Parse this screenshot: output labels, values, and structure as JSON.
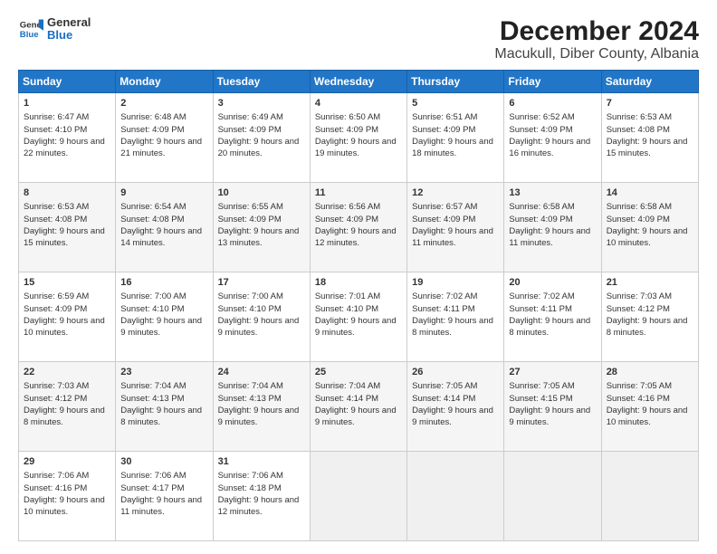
{
  "header": {
    "logo_general": "General",
    "logo_blue": "Blue",
    "title": "December 2024",
    "subtitle": "Macukull, Diber County, Albania"
  },
  "days_of_week": [
    "Sunday",
    "Monday",
    "Tuesday",
    "Wednesday",
    "Thursday",
    "Friday",
    "Saturday"
  ],
  "weeks": [
    [
      {
        "day": "1",
        "sunrise": "6:47 AM",
        "sunset": "4:10 PM",
        "daylight": "9 hours and 22 minutes."
      },
      {
        "day": "2",
        "sunrise": "6:48 AM",
        "sunset": "4:09 PM",
        "daylight": "9 hours and 21 minutes."
      },
      {
        "day": "3",
        "sunrise": "6:49 AM",
        "sunset": "4:09 PM",
        "daylight": "9 hours and 20 minutes."
      },
      {
        "day": "4",
        "sunrise": "6:50 AM",
        "sunset": "4:09 PM",
        "daylight": "9 hours and 19 minutes."
      },
      {
        "day": "5",
        "sunrise": "6:51 AM",
        "sunset": "4:09 PM",
        "daylight": "9 hours and 18 minutes."
      },
      {
        "day": "6",
        "sunrise": "6:52 AM",
        "sunset": "4:09 PM",
        "daylight": "9 hours and 16 minutes."
      },
      {
        "day": "7",
        "sunrise": "6:53 AM",
        "sunset": "4:08 PM",
        "daylight": "9 hours and 15 minutes."
      }
    ],
    [
      {
        "day": "8",
        "sunrise": "6:53 AM",
        "sunset": "4:08 PM",
        "daylight": "9 hours and 15 minutes."
      },
      {
        "day": "9",
        "sunrise": "6:54 AM",
        "sunset": "4:08 PM",
        "daylight": "9 hours and 14 minutes."
      },
      {
        "day": "10",
        "sunrise": "6:55 AM",
        "sunset": "4:09 PM",
        "daylight": "9 hours and 13 minutes."
      },
      {
        "day": "11",
        "sunrise": "6:56 AM",
        "sunset": "4:09 PM",
        "daylight": "9 hours and 12 minutes."
      },
      {
        "day": "12",
        "sunrise": "6:57 AM",
        "sunset": "4:09 PM",
        "daylight": "9 hours and 11 minutes."
      },
      {
        "day": "13",
        "sunrise": "6:58 AM",
        "sunset": "4:09 PM",
        "daylight": "9 hours and 11 minutes."
      },
      {
        "day": "14",
        "sunrise": "6:58 AM",
        "sunset": "4:09 PM",
        "daylight": "9 hours and 10 minutes."
      }
    ],
    [
      {
        "day": "15",
        "sunrise": "6:59 AM",
        "sunset": "4:09 PM",
        "daylight": "9 hours and 10 minutes."
      },
      {
        "day": "16",
        "sunrise": "7:00 AM",
        "sunset": "4:10 PM",
        "daylight": "9 hours and 9 minutes."
      },
      {
        "day": "17",
        "sunrise": "7:00 AM",
        "sunset": "4:10 PM",
        "daylight": "9 hours and 9 minutes."
      },
      {
        "day": "18",
        "sunrise": "7:01 AM",
        "sunset": "4:10 PM",
        "daylight": "9 hours and 9 minutes."
      },
      {
        "day": "19",
        "sunrise": "7:02 AM",
        "sunset": "4:11 PM",
        "daylight": "9 hours and 8 minutes."
      },
      {
        "day": "20",
        "sunrise": "7:02 AM",
        "sunset": "4:11 PM",
        "daylight": "9 hours and 8 minutes."
      },
      {
        "day": "21",
        "sunrise": "7:03 AM",
        "sunset": "4:12 PM",
        "daylight": "9 hours and 8 minutes."
      }
    ],
    [
      {
        "day": "22",
        "sunrise": "7:03 AM",
        "sunset": "4:12 PM",
        "daylight": "9 hours and 8 minutes."
      },
      {
        "day": "23",
        "sunrise": "7:04 AM",
        "sunset": "4:13 PM",
        "daylight": "9 hours and 8 minutes."
      },
      {
        "day": "24",
        "sunrise": "7:04 AM",
        "sunset": "4:13 PM",
        "daylight": "9 hours and 9 minutes."
      },
      {
        "day": "25",
        "sunrise": "7:04 AM",
        "sunset": "4:14 PM",
        "daylight": "9 hours and 9 minutes."
      },
      {
        "day": "26",
        "sunrise": "7:05 AM",
        "sunset": "4:14 PM",
        "daylight": "9 hours and 9 minutes."
      },
      {
        "day": "27",
        "sunrise": "7:05 AM",
        "sunset": "4:15 PM",
        "daylight": "9 hours and 9 minutes."
      },
      {
        "day": "28",
        "sunrise": "7:05 AM",
        "sunset": "4:16 PM",
        "daylight": "9 hours and 10 minutes."
      }
    ],
    [
      {
        "day": "29",
        "sunrise": "7:06 AM",
        "sunset": "4:16 PM",
        "daylight": "9 hours and 10 minutes."
      },
      {
        "day": "30",
        "sunrise": "7:06 AM",
        "sunset": "4:17 PM",
        "daylight": "9 hours and 11 minutes."
      },
      {
        "day": "31",
        "sunrise": "7:06 AM",
        "sunset": "4:18 PM",
        "daylight": "9 hours and 12 minutes."
      },
      null,
      null,
      null,
      null
    ]
  ],
  "labels": {
    "sunrise": "Sunrise:",
    "sunset": "Sunset:",
    "daylight": "Daylight:"
  }
}
